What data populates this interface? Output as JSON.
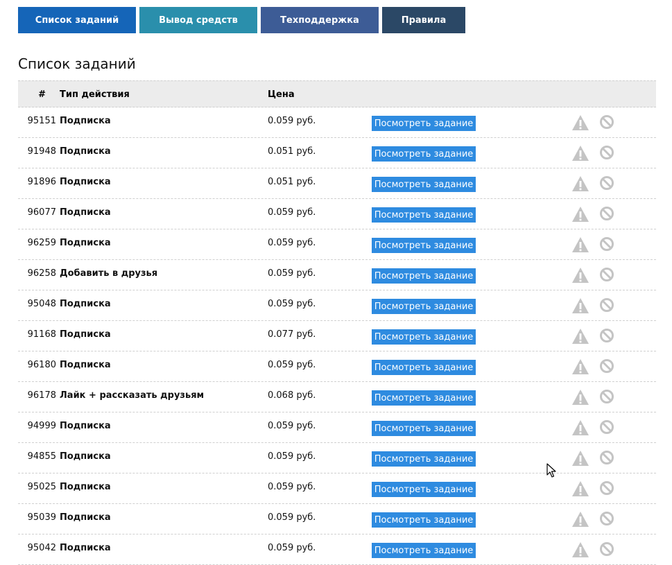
{
  "nav": {
    "items": [
      {
        "label": "Список заданий"
      },
      {
        "label": "Вывод средств"
      },
      {
        "label": "Техподдержка"
      },
      {
        "label": "Правила"
      }
    ]
  },
  "page": {
    "title": "Список заданий"
  },
  "table": {
    "headers": {
      "num": "#",
      "type": "Тип действия",
      "price": "Цена"
    },
    "view_button_label": "Посмотреть задание",
    "icons": {
      "report": "warning-triangle-icon",
      "block": "ban-icon"
    },
    "rows": [
      {
        "id": "95151",
        "type": "Подписка",
        "price": "0.059 руб."
      },
      {
        "id": "91948",
        "type": "Подписка",
        "price": "0.051 руб."
      },
      {
        "id": "91896",
        "type": "Подписка",
        "price": "0.051 руб."
      },
      {
        "id": "96077",
        "type": "Подписка",
        "price": "0.059 руб."
      },
      {
        "id": "96259",
        "type": "Подписка",
        "price": "0.059 руб."
      },
      {
        "id": "96258",
        "type": "Добавить в друзья",
        "price": "0.059 руб."
      },
      {
        "id": "95048",
        "type": "Подписка",
        "price": "0.059 руб."
      },
      {
        "id": "91168",
        "type": "Подписка",
        "price": "0.077 руб."
      },
      {
        "id": "96180",
        "type": "Подписка",
        "price": "0.059 руб."
      },
      {
        "id": "96178",
        "type": "Лайк + рассказать друзьям",
        "price": "0.068 руб."
      },
      {
        "id": "94999",
        "type": "Подписка",
        "price": "0.059 руб."
      },
      {
        "id": "94855",
        "type": "Подписка",
        "price": "0.059 руб."
      },
      {
        "id": "95025",
        "type": "Подписка",
        "price": "0.059 руб."
      },
      {
        "id": "95039",
        "type": "Подписка",
        "price": "0.059 руб."
      },
      {
        "id": "95042",
        "type": "Подписка",
        "price": "0.059 руб."
      }
    ]
  },
  "colors": {
    "nav_tasks": "#1565b8",
    "nav_withdraw": "#2a8fac",
    "nav_support": "#3d5c96",
    "nav_rules": "#2b4866",
    "view_button": "#2e8be0",
    "icon_gray": "#c4c4c4"
  }
}
